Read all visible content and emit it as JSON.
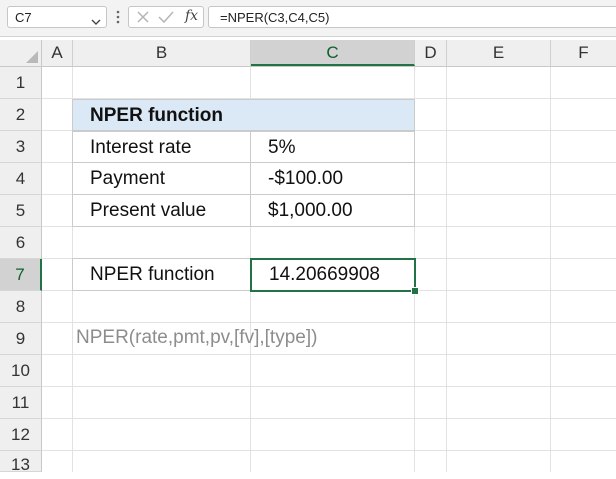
{
  "formula_bar": {
    "name_box": "C7",
    "fx_label": "fx",
    "formula": "=NPER(C3,C4,C5)"
  },
  "columns": [
    "A",
    "B",
    "C",
    "D",
    "E",
    "F"
  ],
  "rows": [
    "1",
    "2",
    "3",
    "4",
    "5",
    "6",
    "7",
    "8",
    "9",
    "10",
    "11",
    "12",
    "13"
  ],
  "selected": {
    "column": "C",
    "row": "7"
  },
  "sheet": {
    "table": {
      "title": "NPER function",
      "rows": [
        {
          "label": "Interest rate",
          "value": "5%"
        },
        {
          "label": "Payment",
          "value": "-$100.00"
        },
        {
          "label": "Present value",
          "value": "$1,000.00"
        }
      ]
    },
    "result": {
      "label": "NPER function",
      "value": "14.20669908"
    },
    "syntax_note": "NPER(rate,pmt,pv,[fv],[type])"
  },
  "colors": {
    "accent": "#217346",
    "title_fill": "#dbe9f6",
    "note_text": "#8d8d8d"
  }
}
